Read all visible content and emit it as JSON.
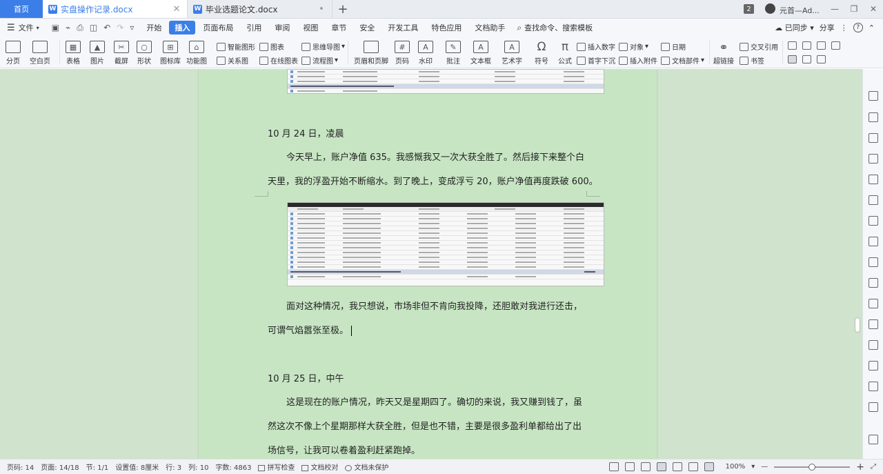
{
  "tabs": {
    "home": "首页",
    "docs": [
      {
        "label": "实盘操作记录.docx",
        "active": true
      },
      {
        "label": "毕业选题论文.docx",
        "active": false
      }
    ],
    "new_tab": "+",
    "badge": "2",
    "user": "元首—Ad..."
  },
  "menu": {
    "file": "文件",
    "items": [
      "开始",
      "插入",
      "页面布局",
      "引用",
      "审阅",
      "视图",
      "章节",
      "安全",
      "开发工具",
      "特色应用",
      "文档助手"
    ],
    "active": "插入",
    "search": "查找命令、搜索模板",
    "sync": "已同步",
    "share": "分享"
  },
  "ribbon": {
    "big": [
      "分页",
      "空白页",
      "表格",
      "图片",
      "截屏",
      "形状",
      "图标库",
      "功能图"
    ],
    "small_top": [
      "智能图形",
      "图表",
      "思维导图"
    ],
    "small_bottom": [
      "关系图",
      "在线图表",
      "流程图"
    ],
    "big2": [
      "页眉和页脚",
      "页码",
      "水印",
      "批注",
      "文本框",
      "艺术字",
      "符号",
      "公式"
    ],
    "small_top2": [
      "插入数字",
      "对象",
      "日期"
    ],
    "small_bottom2": [
      "首字下沉",
      "插入附件",
      "文档部件"
    ],
    "big3": [
      "超链接"
    ],
    "small_top3": [
      "交叉引用"
    ],
    "small_bottom3": [
      "书签"
    ]
  },
  "document": {
    "p1": "10 月 24 日，凌晨",
    "p2": "今天早上，账户净值 635。我感慨我又一次大获全胜了。然后接下来整个白",
    "p3": "天里，我的浮盈开始不断缩水。到了晚上，变成浮亏 20，账户净值再度跌破 600。",
    "p4": "面对这种情况，我只想说，市场非但不肯向我投降，还胆敢对我进行还击，",
    "p5": "可谓气焰嚣张至极。",
    "p6": "10 月 25 日，中午",
    "p7": "这是现在的账户情况，昨天又是星期四了。确切的来说，我又赚到钱了，虽",
    "p8": "然这次不像上个星期那样大获全胜，但是也不错，主要是很多盈利单都给出了出",
    "p9": "场信号，让我可以卷着盈利赶紧跑掉。"
  },
  "status": {
    "page_num": "页码: 14",
    "pages": "页面: 14/18",
    "section": "节: 1/1",
    "setting": "设置值: 8厘米",
    "row": "行: 3",
    "col": "列: 10",
    "words": "字数: 4863",
    "spell": "拼写检查",
    "proof": "文档校对",
    "protect": "文档未保护",
    "zoom": "100%",
    "zoom_fraction": 0.5
  }
}
